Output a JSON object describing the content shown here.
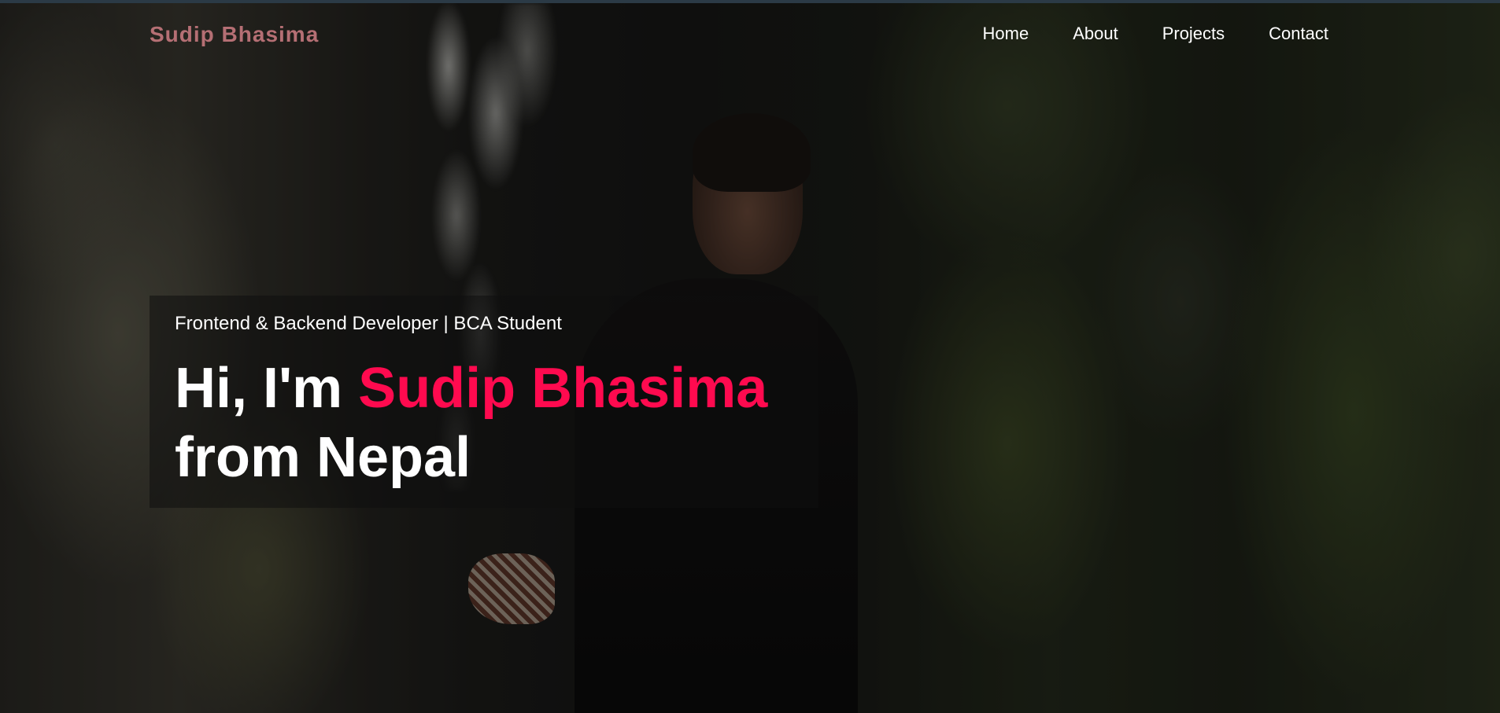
{
  "brand": {
    "name": "Sudip Bhasima",
    "color": "#b56f74"
  },
  "nav": {
    "items": [
      {
        "label": "Home"
      },
      {
        "label": "About"
      },
      {
        "label": "Projects"
      },
      {
        "label": "Contact"
      }
    ]
  },
  "hero": {
    "subtitle": "Frontend & Backend Developer | BCA Student",
    "greeting": "Hi, I'm",
    "highlight_name": "Sudip Bhasima",
    "line2": "from Nepal",
    "accent_color": "#ff0a4f"
  }
}
